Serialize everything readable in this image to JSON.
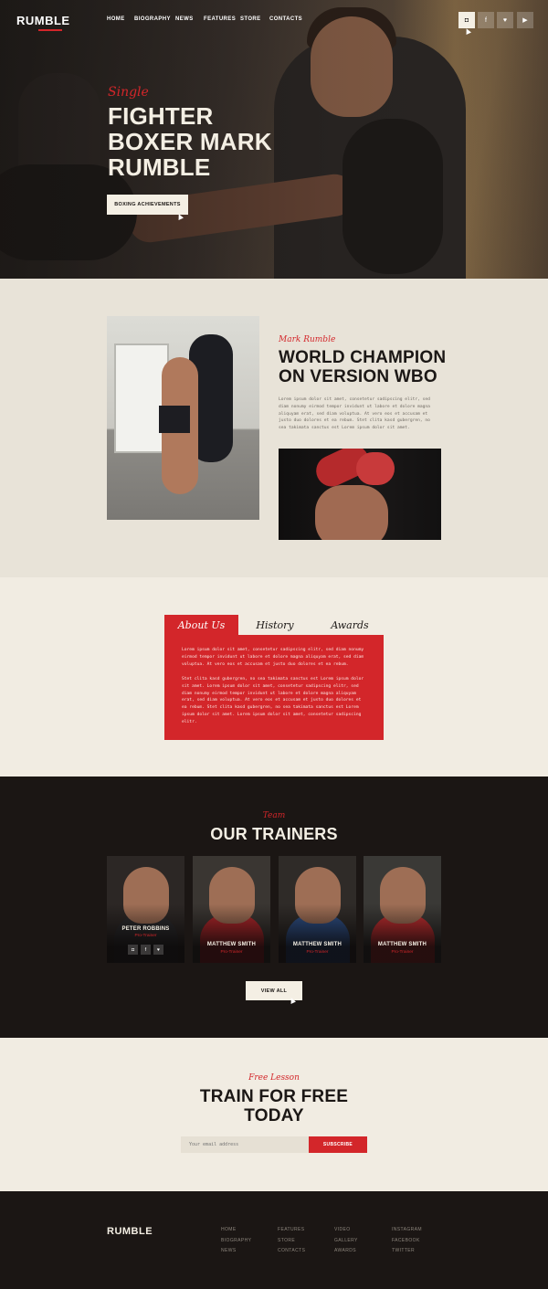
{
  "brand": {
    "logo": "RUMBLE",
    "accent": "#d3262a",
    "dark": "#1b1614",
    "cream": "#f1ece2"
  },
  "nav": {
    "items": [
      "HOME",
      "BIOGRAPHY",
      "NEWS",
      "FEATURES",
      "STORE",
      "CONTACTS"
    ]
  },
  "social_icons": [
    "instagram-icon",
    "facebook-icon",
    "twitter-icon",
    "youtube-icon"
  ],
  "social_glyphs": {
    "instagram": "◘",
    "facebook": "f",
    "twitter": "♥",
    "youtube": "▶"
  },
  "hero": {
    "script": "Single",
    "title_lines": [
      "FIGHTER",
      "BOXER MARK",
      "RUMBLE"
    ],
    "button": "BOXING ACHIEVEMENTS"
  },
  "champion": {
    "script": "Mark Rumble",
    "title_lines": [
      "WORLD CHAMPION",
      "ON VERSION WBO"
    ],
    "text": "Lorem ipsum dolor sit amet, consetetur sadipscing elitr, sed diam nonumy eirmod tempor invidunt ut labore et dolore magna aliquyam erat, sed diam voluptua. At vero eos et accusam et justo duo dolores et ea rebum. Stet clita kasd gubergren, no sea takimata sanctus est Lorem ipsum dolor sit amet."
  },
  "tabs": {
    "items": [
      "About Us",
      "History",
      "Awards"
    ],
    "paragraph1": "Lorem ipsum dolor sit amet, consetetur sadipscing elitr, sed diam nonumy eirmod tempor invidunt ut labore et dolore magna aliquyam erat, sed diam voluptua. At vero eos et accusam et justo duo dolores et ea rebum.",
    "paragraph2": "Stet clita kasd gubergren, no sea takimata sanctus est Lorem ipsum dolor sit amet. Lorem ipsum dolor sit amet, consetetur sadipscing elitr, sed diam nonumy eirmod tempor invidunt ut labore et dolore magna aliquyam erat, sed diam voluptua. At vero eos et accusam et justo duo dolores et ea rebum. Stet clita kasd gubergren, no sea takimata sanctus est Lorem ipsum dolor sit amet. Lorem ipsum dolor sit amet, consetetur sadipscing elitr."
  },
  "trainers": {
    "script": "Team",
    "title": "OUR TRAINERS",
    "cards": [
      {
        "name": "PETER ROBBINS",
        "role": "Pro-Trainer",
        "torso_color": "#2a2a2c",
        "bg": "#2c2725"
      },
      {
        "name": "MATTHEW SMITH",
        "role": "Pro-Trainer",
        "torso_color": "#b3262a",
        "bg": "#3a3632"
      },
      {
        "name": "MATTHEW SMITH",
        "role": "Pro-Trainer",
        "torso_color": "#2d4f86",
        "bg": "#2f2b28"
      },
      {
        "name": "MATTHEW SMITH",
        "role": "Pro-Trainer",
        "torso_color": "#c22d2f",
        "bg": "#3a3936"
      }
    ],
    "view_all": "VIEW ALL"
  },
  "free_lesson": {
    "script": "Free Lesson",
    "title_lines": [
      "TRAIN FOR FREE",
      "TODAY"
    ],
    "email_placeholder": "Your email address",
    "subscribe": "SUBSCRIBE"
  },
  "footer": {
    "logo": "RUMBLE",
    "columns": [
      [
        "HOME",
        "BIOGRAPHY",
        "NEWS"
      ],
      [
        "FEATURES",
        "STORE",
        "CONTACTS"
      ],
      [
        "VIDEO",
        "GALLERY",
        "AWARDS"
      ],
      [
        "INSTAGRAM",
        "FACEBOOK",
        "TWITTER"
      ]
    ]
  }
}
